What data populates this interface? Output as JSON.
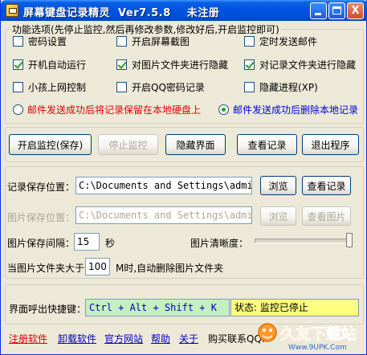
{
  "window": {
    "title": "屏幕键盘记录精灵  Ver7.5.8    未注册",
    "min_label": "_",
    "max_label": "□",
    "close_label": "X"
  },
  "options": {
    "legend": "功能选项(先停止监控,然后再修改参数,修改好后,开启监控即可)",
    "items": [
      {
        "label": "密码设置",
        "checked": false
      },
      {
        "label": "开启屏幕截图",
        "checked": false
      },
      {
        "label": "定时发送邮件",
        "checked": false
      },
      {
        "label": "开机自动运行",
        "checked": true
      },
      {
        "label": "对图片文件夹进行隐藏",
        "checked": true
      },
      {
        "label": "对记录文件夹进行隐藏",
        "checked": true
      },
      {
        "label": "小孩上网控制",
        "checked": false
      },
      {
        "label": "开启QQ密码记录",
        "checked": false
      },
      {
        "label": "隐藏进程(XP)",
        "checked": false
      }
    ],
    "radio_keep_local": "邮件发送成功后将记录保留在本地硬盘上",
    "radio_delete_local": "邮件发送成功后删除本地记录",
    "radio_selected": "delete"
  },
  "actions": {
    "start": "开启监控(保存)",
    "stop": "停止监控",
    "hide": "隐藏界面",
    "view": "查看记录",
    "exit": "退出程序"
  },
  "paths": {
    "record_label": "记录保存位置：",
    "record_value": "C:\\Documents and Settings\\admin",
    "record_browse": "浏览",
    "record_view": "查看记录",
    "image_label": "图片保存位置：",
    "image_value": "C:\\Documents and Settings\\admin",
    "image_browse": "浏览",
    "image_view": "查看图片",
    "interval_label": "图片保存间隔：",
    "interval_value": "15",
    "interval_unit": "秒",
    "clarity_label": "图片清晰度：",
    "clarity_level": 1.0,
    "limit_prefix": "当图片文件夹大于",
    "limit_value": "100",
    "limit_suffix": "M时,自动删除图片文件夹"
  },
  "hotkey": {
    "label": "界面呼出快捷键：",
    "value": "Ctrl + Alt + Shift + K",
    "status": "状态: 监控已停止"
  },
  "links": {
    "register": "注册软件",
    "uninstall": "卸载软件",
    "website": "官方网站",
    "help": "帮助",
    "about": "关于",
    "buy": "购买联系QQ:"
  },
  "watermark": {
    "brand": "久友下载站",
    "url": "Www.9UPK.Com"
  },
  "colors": {
    "accent_blue": "#0053e1",
    "warning_red": "#e00000",
    "link_blue": "#0000c0",
    "hotkey_bg": "#c4f0c0",
    "status_bg": "#ffff80"
  }
}
